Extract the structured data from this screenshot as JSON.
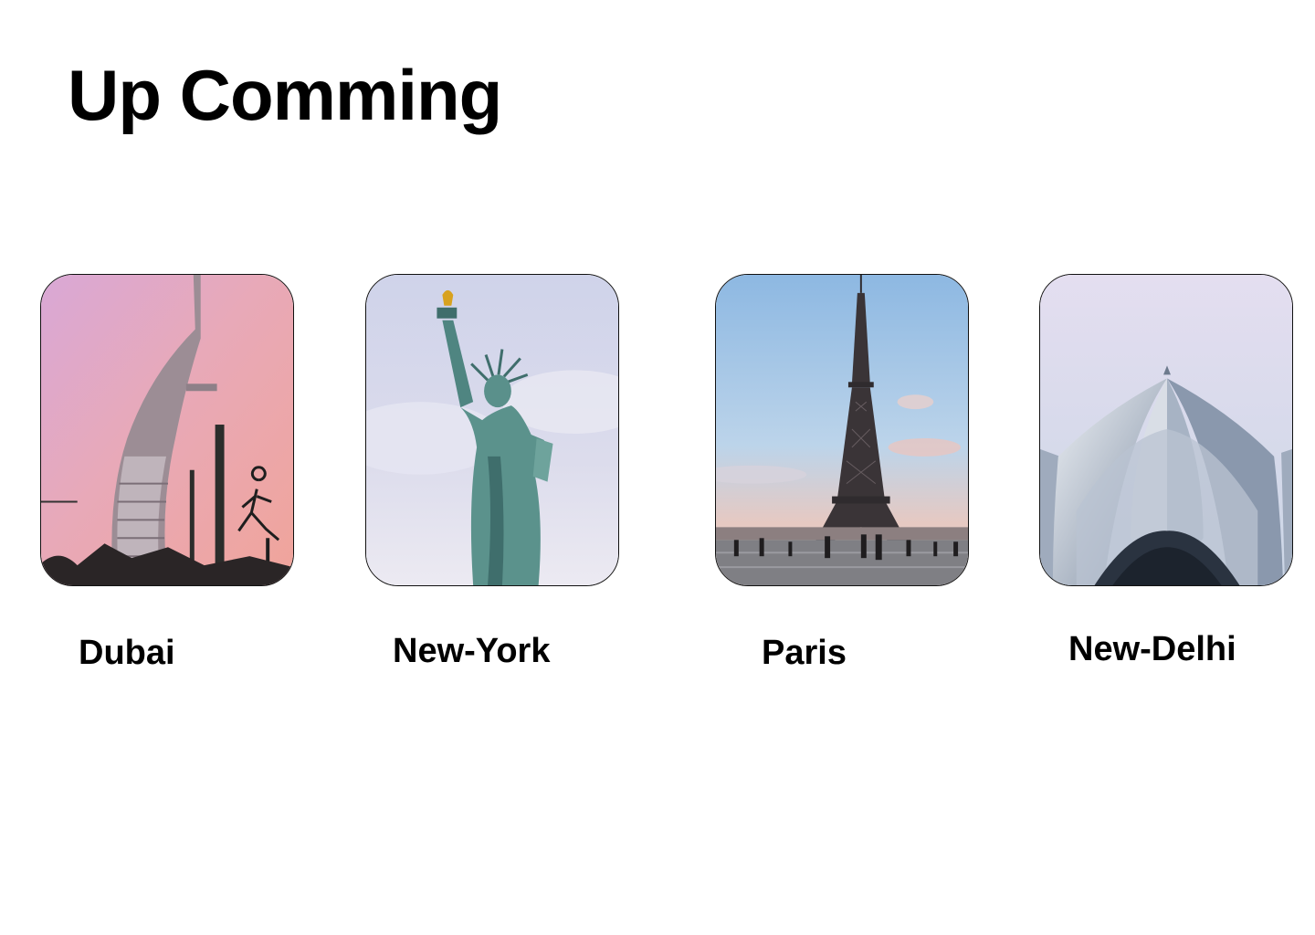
{
  "page": {
    "title": "Up Comming"
  },
  "cities": [
    {
      "name": "Dubai",
      "image": "burj-al-arab-photo"
    },
    {
      "name": "New-York",
      "image": "statue-of-liberty-photo"
    },
    {
      "name": "Paris",
      "image": "eiffel-tower-photo"
    },
    {
      "name": "New-Delhi",
      "image": "lotus-temple-photo"
    }
  ]
}
